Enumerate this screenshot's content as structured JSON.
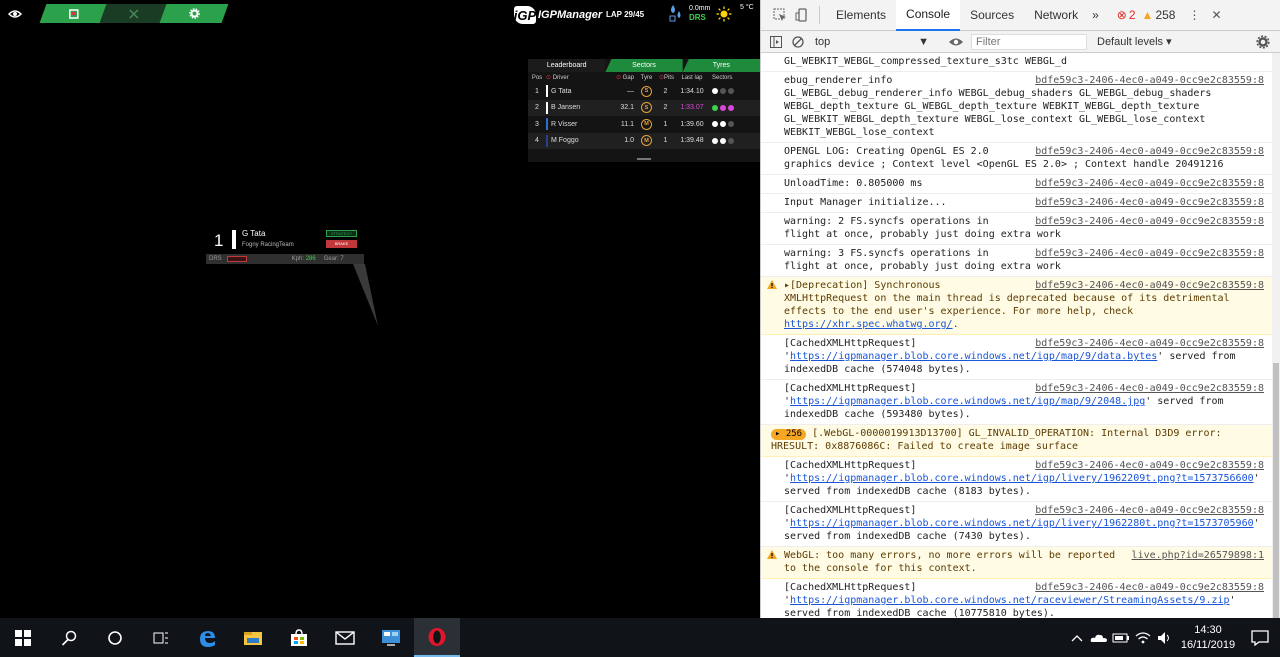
{
  "game": {
    "brand": "IGPManager",
    "brand_mark": "iGP",
    "lap": "LAP 29/45",
    "weather": {
      "rain": "0.0mm",
      "drs": "DRS",
      "temp": "5 °C"
    },
    "leaderboard": {
      "tabs": [
        "Leaderboard",
        "Sectors",
        "Tyres"
      ],
      "headers": {
        "pos": "Pos",
        "driver": "Driver",
        "gap": "Gap",
        "tyre": "Tyre",
        "pits": "Pits",
        "last_lap": "Last lap",
        "sectors": "Sectors"
      },
      "rows": [
        {
          "pos": "1",
          "driver": "G Tata",
          "gap": "—",
          "tyre": "S",
          "pits": "2",
          "last_lap": "1:34.10",
          "team_color": "#ffffff",
          "best": false,
          "sectors": [
            "#ffffff",
            "#555555",
            "#555555"
          ]
        },
        {
          "pos": "2",
          "driver": "B Jansen",
          "gap": "32.1",
          "tyre": "S",
          "pits": "2",
          "last_lap": "1:33.07",
          "team_color": "#ffffff",
          "best": true,
          "sectors": [
            "#3fd04f",
            "#d848d8",
            "#d848d8"
          ]
        },
        {
          "pos": "3",
          "driver": "R Visser",
          "gap": "11.1",
          "tyre": "M",
          "pits": "1",
          "last_lap": "1:39.60",
          "team_color": "#2b6fd6",
          "best": false,
          "sectors": [
            "#ffffff",
            "#ffffff",
            "#555555"
          ]
        },
        {
          "pos": "4",
          "driver": "M Foggo",
          "gap": "1.0",
          "tyre": "M",
          "pits": "1",
          "last_lap": "1:39.48",
          "team_color": "#2b3f8f",
          "best": false,
          "sectors": [
            "#ffffff",
            "#ffffff",
            "#555555"
          ]
        }
      ]
    },
    "popup": {
      "pos": "1",
      "driver": "G Tata",
      "team": "Fogny RacingTeam",
      "btn1": "STRATEGY",
      "btn2": "BRAKE",
      "drs": "DRS",
      "kph_label": "Kph:",
      "kph": "286",
      "gear_label": "Gear:",
      "gear": "7"
    }
  },
  "devtools": {
    "tabs": [
      "Elements",
      "Console",
      "Sources",
      "Network"
    ],
    "active_tab": "Console",
    "errors": "2",
    "warnings": "258",
    "context": "top",
    "filter_placeholder": "Filter",
    "levels": "Default levels",
    "messages": [
      {
        "type": "log",
        "text": "GL_WEBKIT_WEBGL_compressed_texture_s3tc WEBGL_d",
        "src": ""
      },
      {
        "type": "log",
        "text": "ebug_renderer_info GL_WEBGL_debug_renderer_info WEBGL_debug_shaders GL_WEBGL_debug_shaders WEBGL_depth_texture GL_WEBGL_depth_texture WEBKIT_WEBGL_depth_texture GL_WEBKIT_WEBGL_depth_texture WEBGL_lose_context GL_WEBGL_lose_context WEBKIT_WEBGL_lose_context",
        "src": "bdfe59c3-2406-4ec0-a049-0cc9e2c83559:8"
      },
      {
        "type": "log",
        "text": "OPENGL LOG: Creating OpenGL ES 2.0 graphics device ; Context level  <OpenGL ES 2.0> ; Context handle 20491216",
        "src": "bdfe59c3-2406-4ec0-a049-0cc9e2c83559:8"
      },
      {
        "type": "log",
        "text": "UnloadTime: 0.805000 ms",
        "src": "bdfe59c3-2406-4ec0-a049-0cc9e2c83559:8"
      },
      {
        "type": "log",
        "text": "Input Manager initialize...",
        "src": "bdfe59c3-2406-4ec0-a049-0cc9e2c83559:8"
      },
      {
        "type": "log",
        "text": "warning: 2 FS.syncfs operations in flight at once, probably just doing extra work",
        "src": "bdfe59c3-2406-4ec0-a049-0cc9e2c83559:8"
      },
      {
        "type": "log",
        "text": "warning: 3 FS.syncfs operations in flight at once, probably just doing extra work",
        "src": "bdfe59c3-2406-4ec0-a049-0cc9e2c83559:8"
      },
      {
        "type": "warn",
        "text": "▸[Deprecation] Synchronous XMLHttpRequest on the main thread is deprecated because of its detrimental effects to the end user's experience. For more help, check ",
        "link": "https://xhr.spec.whatwg.org/",
        "after": ".",
        "src": "bdfe59c3-2406-4ec0-a049-0cc9e2c83559:8"
      },
      {
        "type": "log",
        "text": "[CachedXMLHttpRequest] '",
        "link": "https://igpmanager.blob.core.windows.net/igp/map/9/data.bytes",
        "after": "' served from indexedDB cache (574048 bytes).",
        "src": "bdfe59c3-2406-4ec0-a049-0cc9e2c83559:8"
      },
      {
        "type": "log",
        "text": "[CachedXMLHttpRequest] '",
        "link": "https://igpmanager.blob.core.windows.net/igp/map/9/2048.jpg",
        "after": "' served from indexedDB cache (593480 bytes).",
        "src": "bdfe59c3-2406-4ec0-a049-0cc9e2c83559:8"
      },
      {
        "type": "warn",
        "badge": "256",
        "text": "[.WebGL-0000019913D13700] GL_INVALID_OPERATION: Internal D3D9 error: HRESULT: 0x8876086C: Failed to create image surface",
        "src": ""
      },
      {
        "type": "log",
        "text": "[CachedXMLHttpRequest] '",
        "link": "https://igpmanager.blob.core.windows.net/igp/livery/1962209t.png?t=1573756600",
        "after": "' served from indexedDB cache (8183 bytes).",
        "src": "bdfe59c3-2406-4ec0-a049-0cc9e2c83559:8"
      },
      {
        "type": "log",
        "text": "[CachedXMLHttpRequest] '",
        "link": "https://igpmanager.blob.core.windows.net/igp/livery/1962280t.png?t=1573705960",
        "after": "' served from indexedDB cache (7430 bytes).",
        "src": "bdfe59c3-2406-4ec0-a049-0cc9e2c83559:8"
      },
      {
        "type": "warn",
        "text": "WebGL: too many errors, no more errors will be reported to the console for this context.",
        "src": "live.php?id=26579898:1"
      },
      {
        "type": "log",
        "text": "[CachedXMLHttpRequest] '",
        "link": "https://igpmanager.blob.core.windows.net/raceviewer/StreamingAssets/9.zip",
        "after": "' served from indexedDB cache (10775810 bytes).",
        "src": "bdfe59c3-2406-4ec0-a049-0cc9e2c83559:8"
      }
    ]
  },
  "taskbar": {
    "time": "14:30",
    "date": "16/11/2019"
  }
}
